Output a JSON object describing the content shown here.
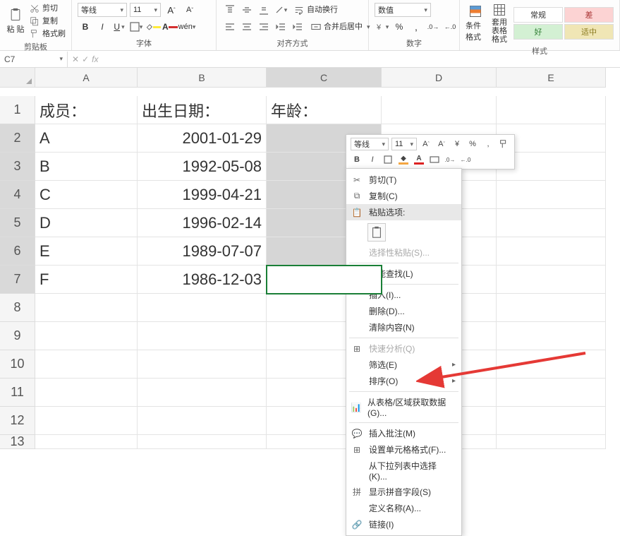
{
  "ribbon": {
    "clipboard": {
      "paste_label": "粘 贴",
      "cut_label": "剪切",
      "copy_label": "复制",
      "format_painter_label": "格式刷",
      "group_label": "剪贴板"
    },
    "font": {
      "font_name": "等线",
      "font_size": "11",
      "increase_label": "A˄",
      "decrease_label": "A˅",
      "bold_label": "B",
      "italic_label": "I",
      "underline_label": "U",
      "group_label": "字体"
    },
    "alignment": {
      "wrap_label": "自动换行",
      "merge_label": "合并后居中",
      "group_label": "对齐方式"
    },
    "number": {
      "format_name": "数值",
      "group_label": "数字"
    },
    "styles": {
      "cond_fmt_label": "条件格式",
      "table_fmt_label": "套用 表格格式",
      "normal_label": "常规",
      "bad_label": "差",
      "good_label": "好",
      "neutral_label": "适中",
      "group_label": "样式"
    }
  },
  "formula_bar": {
    "name_box": "C7",
    "cancel": "✕",
    "confirm": "✓",
    "fx": "fx"
  },
  "sheet": {
    "column_labels": [
      "A",
      "B",
      "C",
      "D",
      "E"
    ],
    "row_labels": [
      "1",
      "2",
      "3",
      "4",
      "5",
      "6",
      "7",
      "8",
      "9",
      "10",
      "11",
      "12",
      "13"
    ],
    "headers": {
      "member": "成员：",
      "dob": "出生日期：",
      "age": "年龄："
    },
    "rows": [
      {
        "member": "A",
        "dob": "2001-01-29",
        "age": ""
      },
      {
        "member": "B",
        "dob": "1992-05-08",
        "age": ""
      },
      {
        "member": "C",
        "dob": "1999-04-21",
        "age": ""
      },
      {
        "member": "D",
        "dob": "1996-02-14",
        "age": ""
      },
      {
        "member": "E",
        "dob": "1989-07-07",
        "age": ""
      },
      {
        "member": "F",
        "dob": "1986-12-03",
        "age": ""
      }
    ],
    "active_cell": "C7",
    "selected_range": "C2:C7"
  },
  "mini_toolbar": {
    "font_name": "等线",
    "font_size": "11",
    "bold": "B",
    "italic": "I"
  },
  "context_menu": {
    "cut": "剪切(T)",
    "copy": "复制(C)",
    "paste_options": "粘贴选项:",
    "paste_special": "选择性粘贴(S)...",
    "smart_lookup": "智能查找(L)",
    "insert": "插入(I)...",
    "delete": "删除(D)...",
    "clear": "清除内容(N)",
    "quick_analysis": "快速分析(Q)",
    "filter": "筛选(E)",
    "sort": "排序(O)",
    "get_data": "从表格/区域获取数据(G)...",
    "insert_comment": "插入批注(M)",
    "format_cells": "设置单元格格式(F)...",
    "pick_from_list": "从下拉列表中选择(K)...",
    "show_phonetic": "显示拼音字段(S)",
    "define_name": "定义名称(A)...",
    "link": "链接(I)"
  }
}
